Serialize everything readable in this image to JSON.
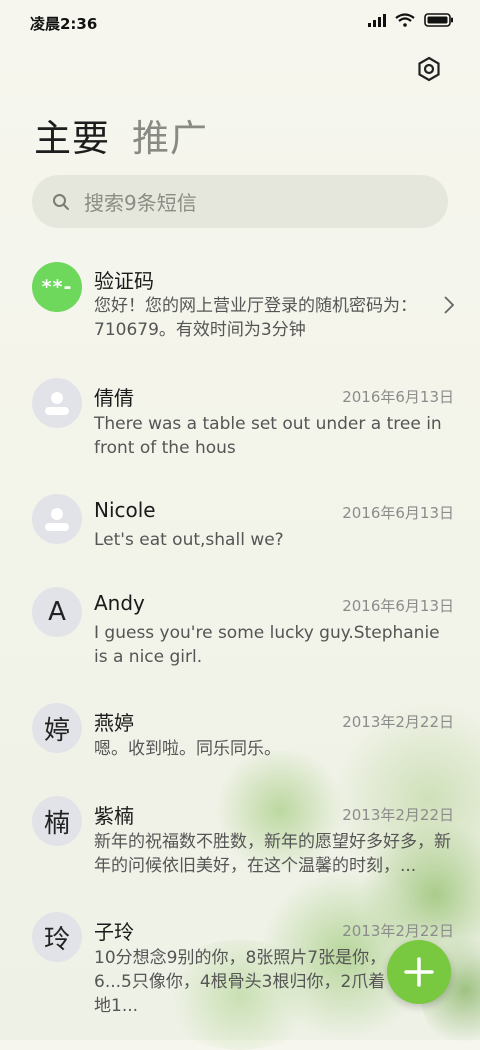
{
  "status": {
    "time": "凌晨2:36"
  },
  "tabs": [
    {
      "label": "主要"
    },
    {
      "label": "推广"
    }
  ],
  "search": {
    "placeholder": "搜索9条短信"
  },
  "conversations": [
    {
      "name": "验证码",
      "avatar_text": "**-",
      "date": "",
      "preview": "您好！您的网上营业厅登录的随机密码为：710679。有效时间为3分钟"
    },
    {
      "name": "倩倩",
      "avatar_text": "",
      "date": "2016年6月13日",
      "preview": "There was a table set out under a tree in front of the hous"
    },
    {
      "name": "Nicole",
      "avatar_text": "",
      "date": "2016年6月13日",
      "preview": "Let's eat out,shall we?"
    },
    {
      "name": "Andy",
      "avatar_text": "A",
      "date": "2016年6月13日",
      "preview": "I guess you're some lucky guy.Stephanie is a nice girl."
    },
    {
      "name": "燕婷",
      "avatar_text": "婷",
      "date": "2013年2月22日",
      "preview": "嗯。收到啦。同乐同乐。"
    },
    {
      "name": "紫楠",
      "avatar_text": "楠",
      "date": "2013年2月22日",
      "preview": "新年的祝福数不胜数，新年的愿望好多好多，新年的问候依旧美好，在这个温馨的时刻，..."
    },
    {
      "name": "子玲",
      "avatar_text": "玲",
      "date": "2013年2月22日",
      "preview": "10分想念9别的你，8张照片7张是你，6...5只像你，4根骨头3根归你，2爪着地1..."
    }
  ],
  "colors": {
    "accent": "#78c93f",
    "code_avatar": "#6dd85c"
  },
  "icons": {
    "settings": "settings-hexagon-icon",
    "search": "search-icon",
    "new": "plus-icon"
  }
}
